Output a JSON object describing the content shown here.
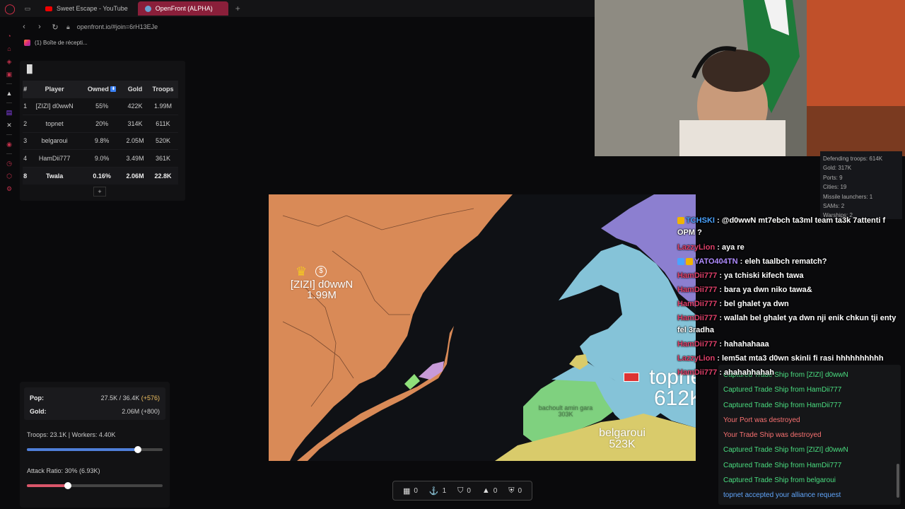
{
  "browser": {
    "tabs": [
      {
        "title": "Sweet Escape - YouTube",
        "icon": "youtube-icon"
      },
      {
        "title": "OpenFront (ALPHA)",
        "icon": "globe-icon"
      }
    ],
    "url": "openfront.io/#join=6rH13EJe",
    "bookmark": "(1) Boîte de récepti..."
  },
  "leaderboard": {
    "headers": [
      "#",
      "Player",
      "Owned",
      "Gold",
      "Troops"
    ],
    "rows": [
      {
        "rank": "1",
        "player": "[ZIZI] d0wwN",
        "owned": "55%",
        "gold": "422K",
        "troops": "1.99M"
      },
      {
        "rank": "2",
        "player": "topnet",
        "owned": "20%",
        "gold": "314K",
        "troops": "611K"
      },
      {
        "rank": "3",
        "player": "belgaroui",
        "owned": "9.8%",
        "gold": "2.05M",
        "troops": "520K"
      },
      {
        "rank": "4",
        "player": "HamDii777",
        "owned": "9.0%",
        "gold": "3.49M",
        "troops": "361K"
      },
      {
        "rank": "8",
        "player": "Twala",
        "owned": "0.16%",
        "gold": "2.06M",
        "troops": "22.8K"
      }
    ],
    "expand_label": "+"
  },
  "map": {
    "labels": [
      {
        "name": "[ZIZI] d0wwN",
        "troops": "1.99M"
      },
      {
        "name": "topnet",
        "troops": "612K"
      },
      {
        "name": "belgaroui",
        "troops": "523K"
      },
      {
        "name": "bachoult amin gara",
        "troops": "303K"
      }
    ],
    "colors": {
      "zizi": "#d98a57",
      "topnet": "#85c3d8",
      "belgaroui": "#d9cb6b",
      "bachoult": "#7fd17f",
      "purple": "#8c7fd0",
      "water": "#0f1115"
    }
  },
  "control": {
    "pop_label": "Pop:",
    "pop_value": "27.5K / 36.4K",
    "pop_gain": "(+576)",
    "gold_label": "Gold:",
    "gold_value": "2.06M (+800)",
    "troops_text": "Troops: 23.1K | Workers: 4.40K",
    "troops_ratio": 0.82,
    "attack_text": "Attack Ratio: 30% (6.93K)",
    "attack_ratio": 0.3
  },
  "buildbar": [
    {
      "icon": "city-icon",
      "glyph": "▦",
      "count": "0"
    },
    {
      "icon": "anchor-icon",
      "glyph": "⚓",
      "count": "1"
    },
    {
      "icon": "shield-icon",
      "glyph": "⛉",
      "count": "0"
    },
    {
      "icon": "missile-icon",
      "glyph": "▲",
      "count": "0"
    },
    {
      "icon": "sam-icon",
      "glyph": "⛨",
      "count": "0"
    }
  ],
  "player_info": [
    "Defending troops: 614K",
    "Gold: 317K",
    "Ports: 9",
    "Cities: 19",
    "Missile launchers: 1",
    "SAMs: 2",
    "Warships: 2"
  ],
  "chat": [
    {
      "user": "TCHSKI",
      "color": "#4aa3ff",
      "badge": "gold",
      "text": " : @d0wwN mt7ebch ta3ml team ta3k 7attenti f OPM ?"
    },
    {
      "user": "LazzyLion",
      "color": "#e0406a",
      "badge": "",
      "text": " : aya re"
    },
    {
      "user": "YATO404TN",
      "color": "#b08cff",
      "badge": "blue",
      "text": " : eleh taalbch rematch?"
    },
    {
      "user": "HamDii777",
      "color": "#e0406a",
      "badge": "",
      "text": " : ya tchiski kifech tawa"
    },
    {
      "user": "HamDii777",
      "color": "#e0406a",
      "badge": "",
      "text": " : bara ya dwn niko tawa&"
    },
    {
      "user": "HamDii777",
      "color": "#e0406a",
      "badge": "",
      "text": " : bel ghalet ya dwn"
    },
    {
      "user": "HamDii777",
      "color": "#e0406a",
      "badge": "",
      "text": " : wallah bel ghalet ya dwn nji enik chkun tji enty fel 3radha"
    },
    {
      "user": "HamDii777",
      "color": "#e0406a",
      "badge": "",
      "text": " : hahahahaaa"
    },
    {
      "user": "LazzyLion",
      "color": "#e0406a",
      "badge": "",
      "text": " : lem5at mta3 d0wn skinli fi rasi hhhhhhhhhh"
    },
    {
      "user": "HamDii777",
      "color": "#e0406a",
      "badge": "",
      "text": " : ahahahhahah"
    }
  ],
  "events": [
    {
      "text": "Captured Trade Ship from [ZIZI] d0wwN",
      "kind": "good"
    },
    {
      "text": "Captured Trade Ship from HamDii777",
      "kind": "good"
    },
    {
      "text": "Captured Trade Ship from HamDii777",
      "kind": "good"
    },
    {
      "text": "Your Port was destroyed",
      "kind": "bad"
    },
    {
      "text": "Your Trade Ship was destroyed",
      "kind": "bad"
    },
    {
      "text": "Captured Trade Ship from [ZIZI] d0wwN",
      "kind": "good"
    },
    {
      "text": "Captured Trade Ship from HamDii777",
      "kind": "good"
    },
    {
      "text": "Captured Trade Ship from belgaroui",
      "kind": "good"
    },
    {
      "text": "topnet accepted your alliance request",
      "kind": "info"
    }
  ]
}
